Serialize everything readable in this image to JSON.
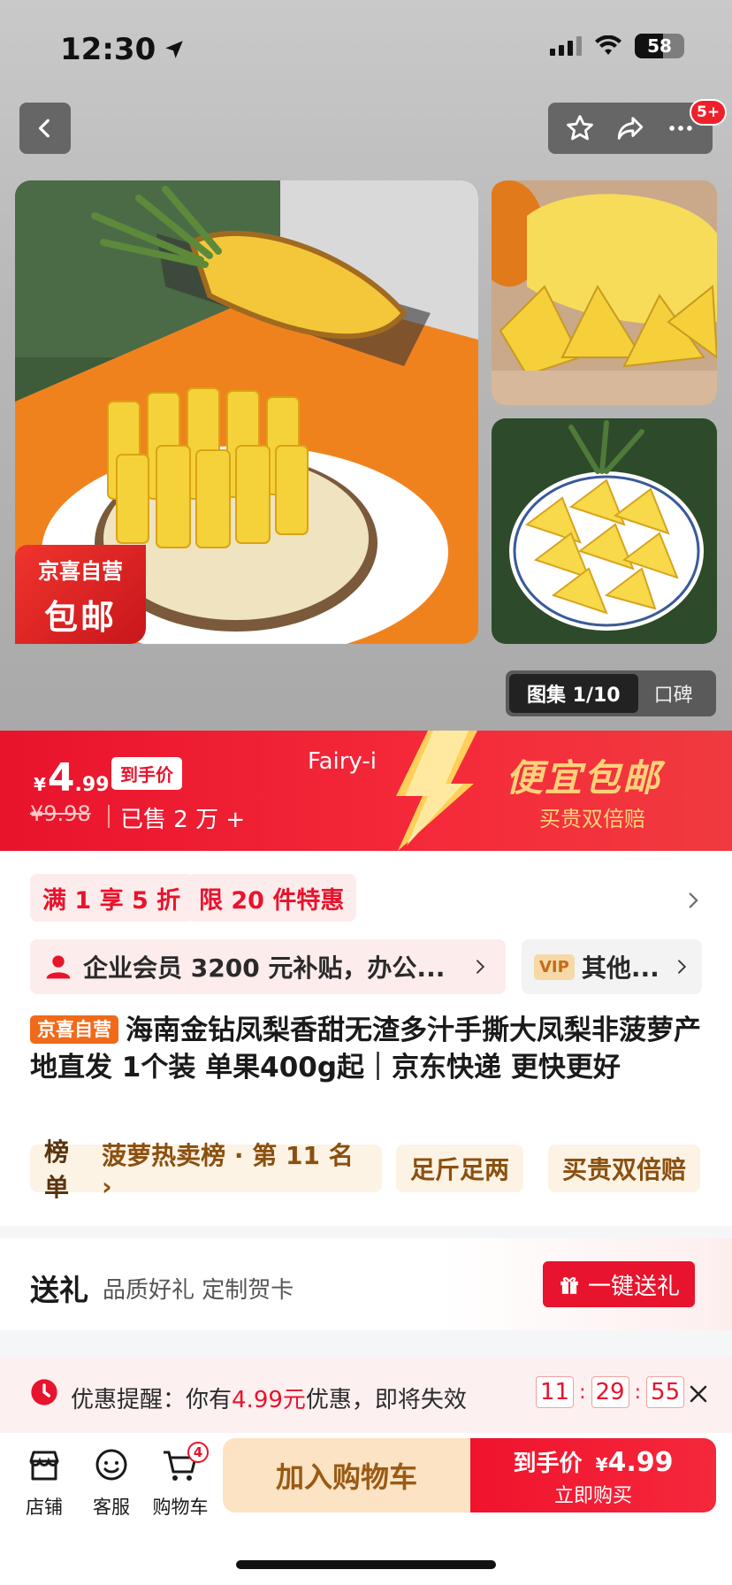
{
  "status_bar": {
    "time": "12:30",
    "battery": "58"
  },
  "header": {
    "cart_badge": "5+"
  },
  "gallery": {
    "stamp_line1": "京喜自营",
    "stamp_line2": "包邮",
    "tab_active": "图集 1/10",
    "tab_other": "口碑"
  },
  "price": {
    "currency": "¥",
    "integer": "4",
    "decimal": ".99",
    "tag": "到手价",
    "original": "¥9.98",
    "sold": "已售 2 万 +",
    "watermark": "Fairy-i",
    "promo_title": "便宜包邮",
    "promo_sub": "买贵双倍赔"
  },
  "coupons": [
    {
      "label": "满 1 享 5 折"
    },
    {
      "label": "限 20 件特惠"
    }
  ],
  "member": {
    "text": "企业会员 3200 元补贴，办公...",
    "vip_logo": "VIP",
    "vip_text": "其他..."
  },
  "product": {
    "self_tag": "京喜自营",
    "title": "海南金钻凤梨香甜无渣多汁手撕大凤梨非菠萝产地直发 1个装 单果400g起｜京东快递 更快更好"
  },
  "tags": {
    "rank_label": "榜单",
    "rank_value": "菠萝热卖榜 · 第 11 名 ›",
    "weight": "足斤足两",
    "guarantee": "买贵双倍赔"
  },
  "gift": {
    "title": "送礼",
    "subtitle": "品质好礼 定制贺卡",
    "button": "一键送礼"
  },
  "reminder": {
    "prefix": "优惠提醒：你有",
    "amount": "4.99元",
    "suffix": "优惠，即将失效",
    "hours": "11",
    "minutes": "29",
    "seconds": "55"
  },
  "bottom_bar": {
    "shop": "店铺",
    "service": "客服",
    "cart": "购物车",
    "cart_count": "4",
    "add_to_cart": "加入购物车",
    "buy_label": "到手价",
    "buy_currency": "¥",
    "buy_price": "4.99",
    "buy_now": "立即购买"
  },
  "colors": {
    "brand_red": "#e8132c",
    "promo_gold": "#ffd27a",
    "cart_beige": "#fbe3c4"
  }
}
